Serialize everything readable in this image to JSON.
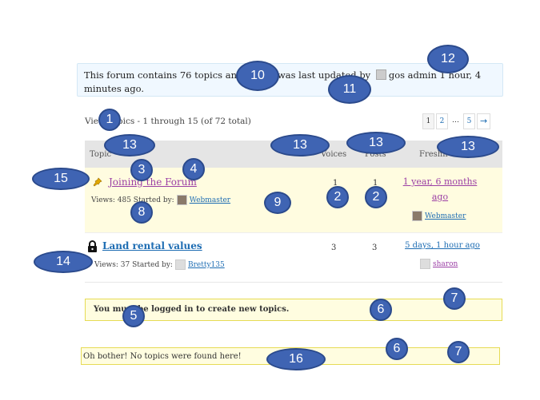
{
  "forum_info": {
    "prefix": "This forum contains 76 topics and 4",
    "middle": ", and was last updated by",
    "user": "gos admin",
    "time_suffix": "1 hour, 4",
    "line2": "minutes ago."
  },
  "view_count": "Vie 6 topics - 1 through 15 (of 72 total)",
  "pagination": {
    "p1": "1",
    "p2": "2",
    "ellipsis": "…",
    "p5": "5",
    "next": "→"
  },
  "table": {
    "col_topic": "Topic",
    "col_voices": "Voices",
    "col_posts": "Posts",
    "col_freshness": "Freshn"
  },
  "topics": [
    {
      "title": "Joining the Forum",
      "views": "Views: 485 Started by:",
      "author": "Webmaster",
      "voices": "1",
      "posts": "1",
      "freshness_line1": "1 year, 6 months",
      "freshness_line2": "ago",
      "last_user": "Webmaster"
    },
    {
      "title": "Land rental values",
      "views": "Views: 37 Started by:",
      "author": "Bretty135",
      "voices": "3",
      "posts": "3",
      "freshness_line1": "5 days, 1 hour ago",
      "last_user": "sharon"
    }
  ],
  "notice": "You must be logged in to create new topics.",
  "empty_notice": "Oh bother! No topics were found here!",
  "markers": {
    "m1": "1",
    "m2": "2",
    "m3": "3",
    "m4": "4",
    "m5": "5",
    "m6": "6",
    "m7": "7",
    "m8": "8",
    "m9": "9",
    "m10": "10",
    "m11": "11",
    "m12": "12",
    "m13": "13",
    "m14": "14",
    "m15": "15",
    "m16": "16"
  }
}
